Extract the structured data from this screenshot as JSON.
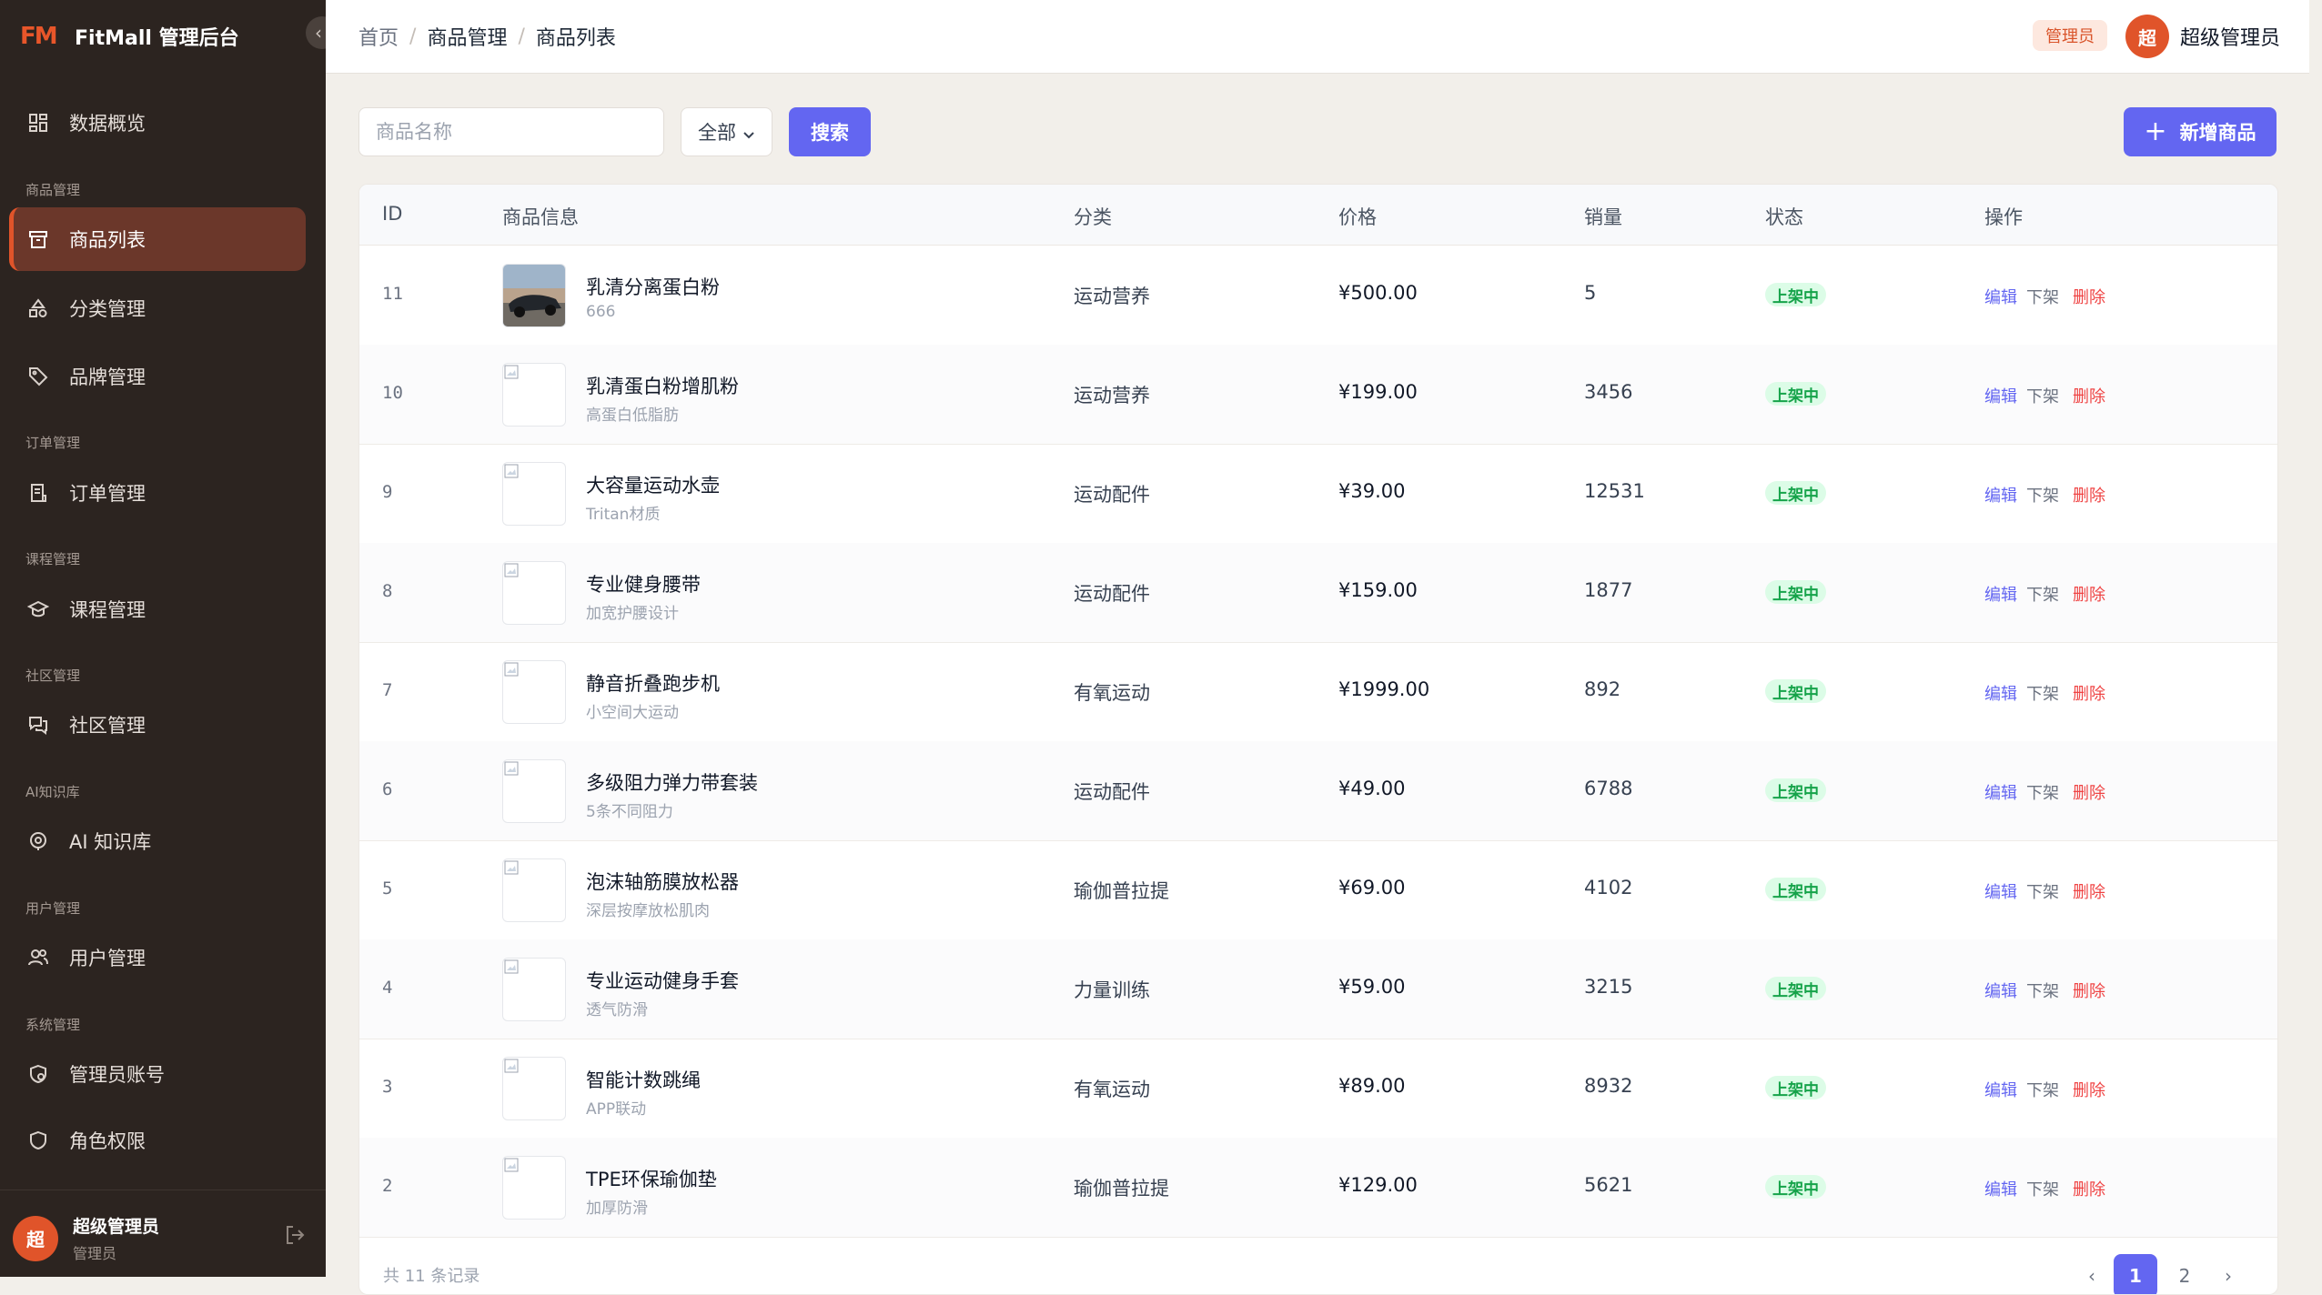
{
  "app": {
    "logo_text": "FM",
    "title": "FitMall 管理后台",
    "collapse_glyph": "‹"
  },
  "sidebar": {
    "items": [
      {
        "label": "数据概览",
        "icon": "dashboard-icon"
      },
      {
        "label": "商品列表",
        "icon": "product-box-icon",
        "active": true
      },
      {
        "label": "分类管理",
        "icon": "category-shapes-icon"
      },
      {
        "label": "品牌管理",
        "icon": "tag-icon"
      },
      {
        "label": "订单管理",
        "icon": "order-receipt-icon"
      },
      {
        "label": "课程管理",
        "icon": "graduation-cap-icon"
      },
      {
        "label": "社区管理",
        "icon": "chat-bubbles-icon"
      },
      {
        "label": "AI 知识库",
        "icon": "ai-brain-icon"
      },
      {
        "label": "用户管理",
        "icon": "users-icon"
      },
      {
        "label": "管理员账号",
        "icon": "admin-shield-icon"
      },
      {
        "label": "角色权限",
        "icon": "role-shield-icon"
      }
    ],
    "groups": [
      "商品管理",
      "订单管理",
      "课程管理",
      "社区管理",
      "AI知识库",
      "用户管理",
      "系统管理"
    ],
    "user": {
      "avatar": "超",
      "name": "超级管理员",
      "role": "管理员"
    }
  },
  "header": {
    "breadcrumb": [
      "首页",
      "商品管理",
      "商品列表"
    ],
    "separator": "/",
    "role_badge": "管理员",
    "avatar": "超",
    "user_name": "超级管理员"
  },
  "toolbar": {
    "search_placeholder": "商品名称",
    "search_value": "",
    "category_value": "全部",
    "search_label": "搜索",
    "add_label": "新增商品",
    "add_glyph": "+"
  },
  "table": {
    "columns": [
      "ID",
      "商品信息",
      "分类",
      "价格",
      "销量",
      "状态",
      "操作"
    ],
    "rows": [
      {
        "id": "11",
        "name": "乳清分离蛋白粉",
        "sub": "666",
        "category": "运动营养",
        "price": "¥500.00",
        "sales": "5",
        "status": "上架中",
        "has_image": true
      },
      {
        "id": "10",
        "name": "乳清蛋白粉增肌粉",
        "sub": "高蛋白低脂肪",
        "category": "运动营养",
        "price": "¥199.00",
        "sales": "3456",
        "status": "上架中"
      },
      {
        "id": "9",
        "name": "大容量运动水壶",
        "sub": "Tritan材质",
        "category": "运动配件",
        "price": "¥39.00",
        "sales": "12531",
        "status": "上架中"
      },
      {
        "id": "8",
        "name": "专业健身腰带",
        "sub": "加宽护腰设计",
        "category": "运动配件",
        "price": "¥159.00",
        "sales": "1877",
        "status": "上架中"
      },
      {
        "id": "7",
        "name": "静音折叠跑步机",
        "sub": "小空间大运动",
        "category": "有氧运动",
        "price": "¥1999.00",
        "sales": "892",
        "status": "上架中"
      },
      {
        "id": "6",
        "name": "多级阻力弹力带套装",
        "sub": "5条不同阻力",
        "category": "运动配件",
        "price": "¥49.00",
        "sales": "6788",
        "status": "上架中"
      },
      {
        "id": "5",
        "name": "泡沫轴筋膜放松器",
        "sub": "深层按摩放松肌肉",
        "category": "瑜伽普拉提",
        "price": "¥69.00",
        "sales": "4102",
        "status": "上架中"
      },
      {
        "id": "4",
        "name": "专业运动健身手套",
        "sub": "透气防滑",
        "category": "力量训练",
        "price": "¥59.00",
        "sales": "3215",
        "status": "上架中"
      },
      {
        "id": "3",
        "name": "智能计数跳绳",
        "sub": "APP联动",
        "category": "有氧运动",
        "price": "¥89.00",
        "sales": "8932",
        "status": "上架中"
      },
      {
        "id": "2",
        "name": "TPE环保瑜伽垫",
        "sub": "加厚防滑",
        "category": "瑜伽普拉提",
        "price": "¥129.00",
        "sales": "5621",
        "status": "上架中"
      }
    ],
    "actions": {
      "edit": "编辑",
      "off_shelf": "下架",
      "delete": "删除"
    }
  },
  "pagination": {
    "total_text": "共 11 条记录",
    "prev": "‹",
    "pages": [
      "1",
      "2"
    ],
    "next": "›",
    "current": "1"
  },
  "colors": {
    "sidebar_bg": "#2c2420",
    "accent_orange": "#e0542a",
    "primary": "#6366f1",
    "success": "#16a34a",
    "danger": "#ef4444"
  }
}
